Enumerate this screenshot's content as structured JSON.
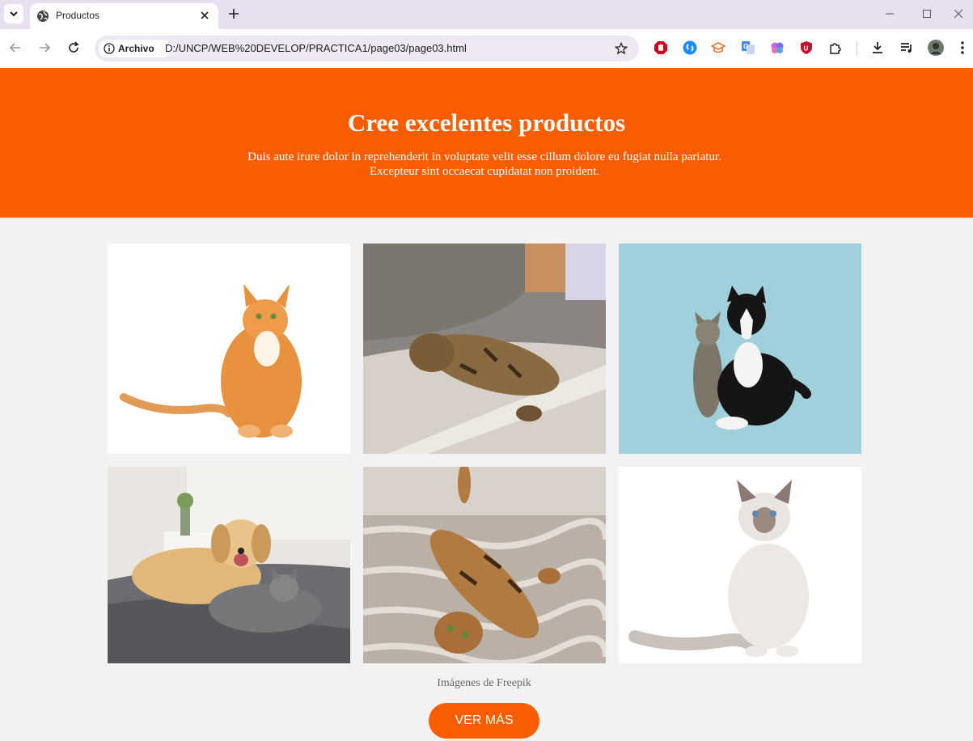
{
  "browser": {
    "tab_title": "Productos",
    "site_chip_label": "Archivo",
    "url": "D:/UNCP/WEB%20DEVELOP/PRACTICA1/page03/page03.html",
    "profile": "avatar"
  },
  "hero": {
    "title": "Cree excelentes productos",
    "text": "Duis aute irure dolor in reprehenderit in voluptate velit esse cillum dolore eu fugiat nulla pariatur. Excepteur sint occaecat cupidatat non proident."
  },
  "gallery": {
    "credit": "Imágenes de Freepik"
  },
  "cta": {
    "label": "VER MÁS"
  },
  "colors": {
    "brand": "#fa5d00",
    "page_bg": "#f2f2f2"
  }
}
